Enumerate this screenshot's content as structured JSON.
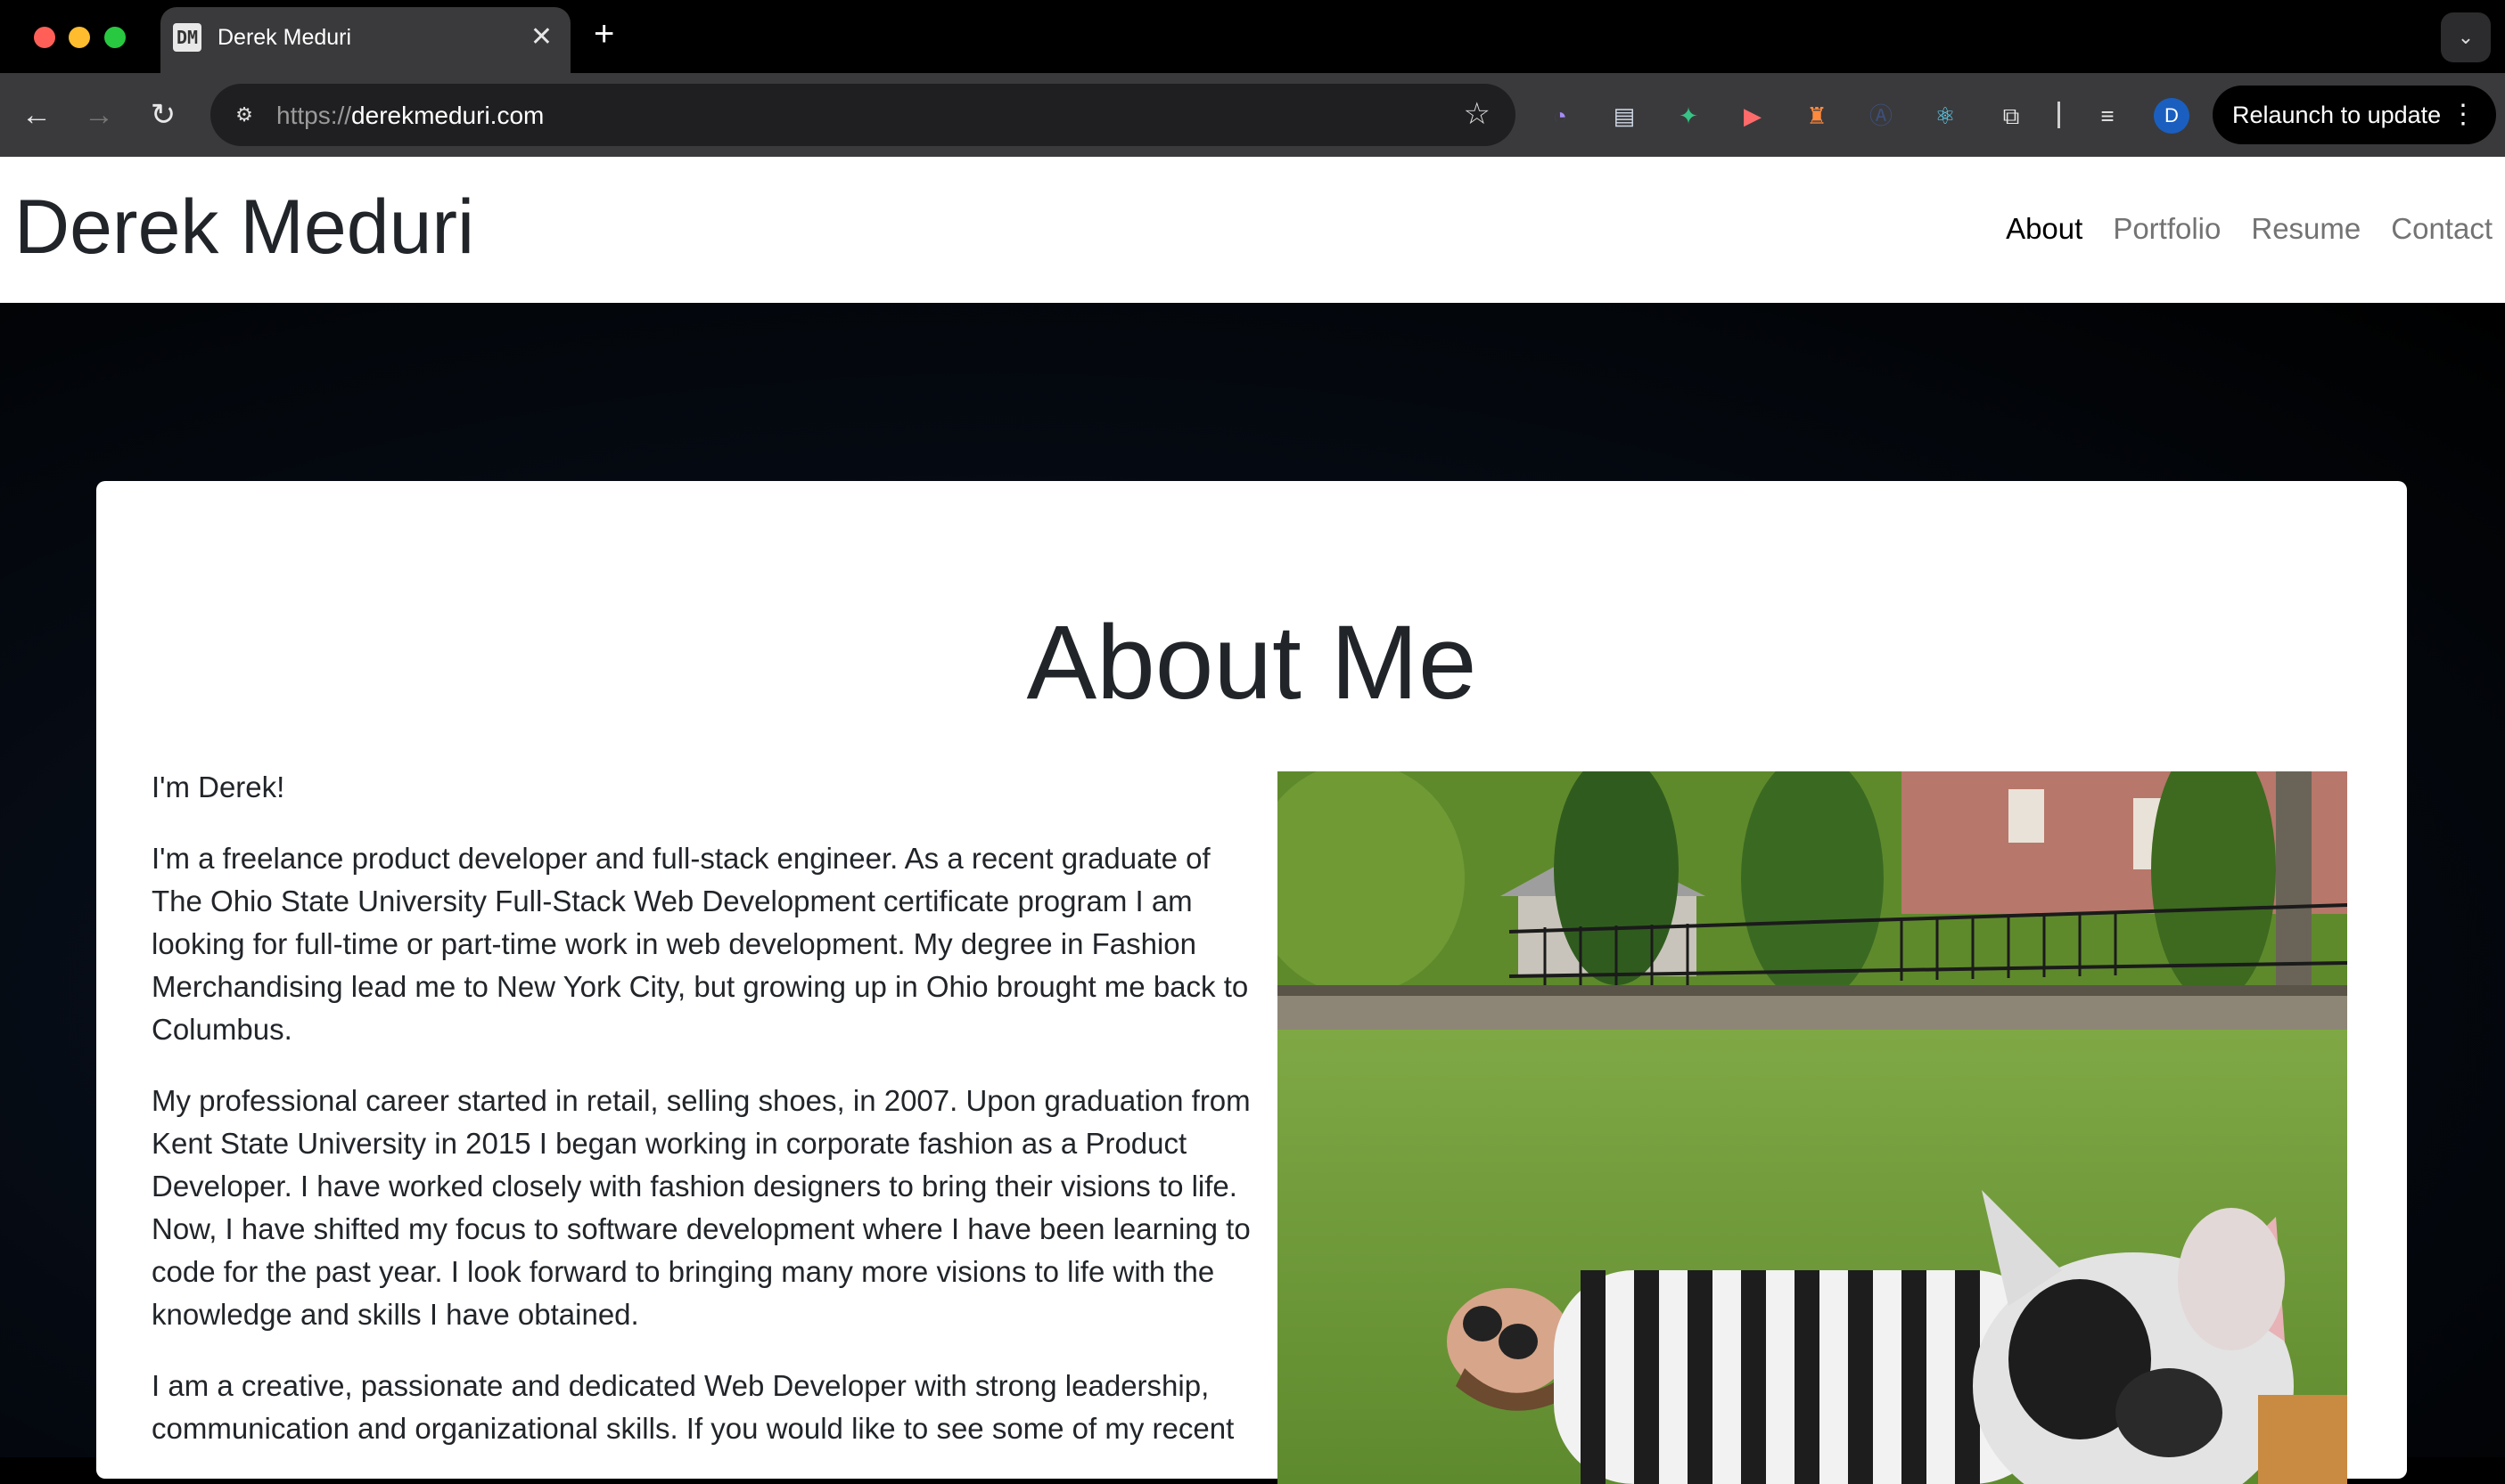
{
  "browser": {
    "tab_title": "Derek Meduri",
    "tab_favicon": "DM",
    "new_tab_symbol": "+",
    "url_protocol": "https://",
    "url_host": "derekmeduri.com",
    "profile_initial": "D",
    "relaunch_label": "Relaunch to update",
    "extensions": [
      "pie-extension-icon",
      "docs-extension-icon",
      "bird-extension-icon",
      "video-extension-icon",
      "figure-extension-icon",
      "a-extension-icon",
      "react-devtools-icon",
      "puzzle-extensions-icon"
    ]
  },
  "site": {
    "name": "Derek Meduri",
    "nav": [
      {
        "label": "About",
        "active": true
      },
      {
        "label": "Portfolio",
        "active": false
      },
      {
        "label": "Resume",
        "active": false
      },
      {
        "label": "Contact",
        "active": false
      }
    ]
  },
  "about": {
    "title": "About Me",
    "paragraphs": [
      "I'm Derek!",
      "I'm a freelance product developer and full-stack engineer. As a recent graduate of The Ohio State University Full-Stack Web Development certificate program I am looking for full-time or part-time work in web development. My degree in Fashion Merchandising lead me to New York City, but growing up in Ohio brought me back to Columbus.",
      "My professional career started in retail, selling shoes, in 2007. Upon graduation from Kent State University in 2015 I began working in corporate fashion as a Product Developer. I have worked closely with fashion designers to bring their visions to life. Now, I have shifted my focus to software development where I have been learning to code for the past year. I look forward to bringing many more visions to life with the knowledge and skills I have obtained.",
      "I am a creative, passionate and dedicated Web Developer with strong leadership, communication and organizational skills. If you would like to see some of my recent"
    ]
  }
}
